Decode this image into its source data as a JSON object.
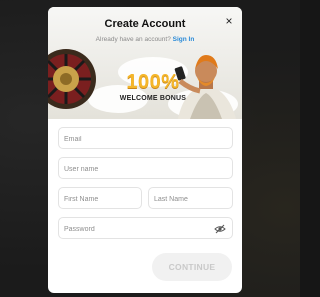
{
  "header": {
    "title": "Create Account",
    "subtitle_prefix": "Already have an account?",
    "signin_link": "Sign In",
    "close_glyph": "×"
  },
  "banner": {
    "bonus_percent": "100%",
    "bonus_label": "WELCOME BONUS"
  },
  "form": {
    "email_placeholder": "Email",
    "username_placeholder": "User name",
    "first_name_placeholder": "First Name",
    "last_name_placeholder": "Last Name",
    "password_placeholder": "Password",
    "password_toggle_icon": "eye-off-icon",
    "continue_label": "CONTINUE"
  },
  "colors": {
    "bonus_gold": "#f5b62a",
    "link_blue": "#2a8bd8",
    "disabled_button_bg": "#f1f1f1",
    "disabled_button_text": "#c9c9c9"
  }
}
